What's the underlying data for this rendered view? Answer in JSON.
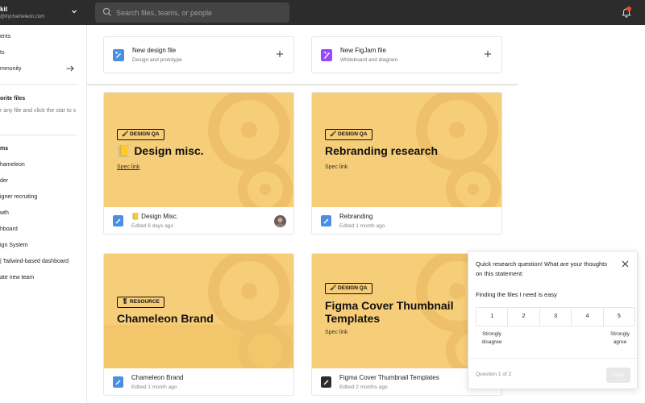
{
  "account": {
    "name": "kit",
    "email": "@trychameleon.com"
  },
  "search": {
    "placeholder": "Search files, teams, or people"
  },
  "sidebar": {
    "nav": [
      "ents",
      "ts",
      "mmunity"
    ],
    "favorites_heading": "orite files",
    "favorites_hint": "r any file and click the star to s",
    "teams_heading": "ms",
    "teams": [
      "hameleon",
      "der",
      "igner recruiting",
      "wth",
      "hboard",
      "ign System",
      "| Tailwind-based dashboard",
      "ate new team"
    ]
  },
  "new_files": [
    {
      "title": "New design file",
      "subtitle": "Design and prototype",
      "icon": "design-file-icon",
      "color": "#4a90e2"
    },
    {
      "title": "New FigJam file",
      "subtitle": "Whiteboard and diagram",
      "icon": "figjam-file-icon",
      "color": "#9747ff"
    }
  ],
  "files": [
    {
      "tag": "🖌 DESIGN QA",
      "thumb_title": "📒 Design misc.",
      "spec": "Spec link",
      "name": "📒 Design Misc.",
      "edited": "Edited 8 days ago"
    },
    {
      "tag": "🖌 DESIGN QA",
      "thumb_title": "Rebranding research",
      "spec": "Spec link",
      "name": "Rebranding",
      "edited": "Edited 1 month ago"
    },
    {
      "tag": "🎖 RESOURCE",
      "thumb_title": "Chameleon Brand",
      "spec": "",
      "name": "Chameleon Brand",
      "edited": "Edited 1 month ago"
    },
    {
      "tag": "🖌 DESIGN QA",
      "thumb_title": "Figma Cover Thumbnail Templates",
      "spec": "Spec link",
      "name": "Figma Cover Thumbnail Templates",
      "edited": "Edited 2 months ago"
    }
  ],
  "survey": {
    "question": "Quick research question! What are your thoughts on this statement:",
    "statement": "Finding the files I need is easy",
    "scale": [
      "1",
      "2",
      "3",
      "4",
      "5"
    ],
    "low_label": "Strongly disagree",
    "high_label": "Strongly agree",
    "progress": "Question 1 of 2",
    "next": "Next"
  },
  "colors": {
    "topbar": "#2c2c2c",
    "thumb": "#f6cd78",
    "accent": "#4a90e2",
    "notification": "#f24822"
  }
}
